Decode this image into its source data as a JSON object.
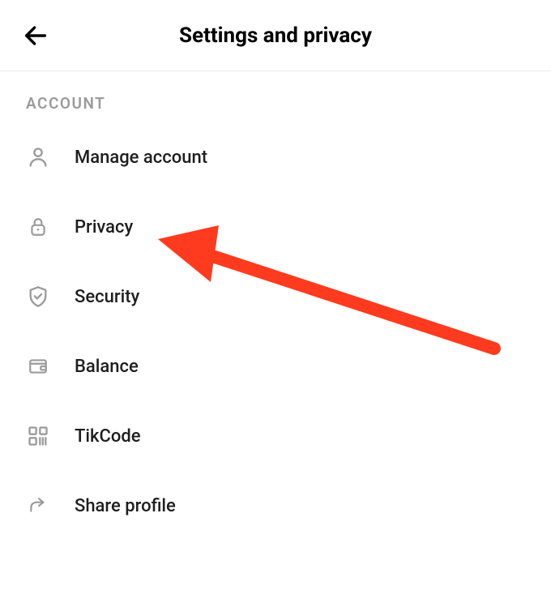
{
  "header": {
    "title": "Settings and privacy"
  },
  "section": {
    "heading": "ACCOUNT"
  },
  "items": [
    {
      "icon": "person",
      "label": "Manage account"
    },
    {
      "icon": "lock",
      "label": "Privacy"
    },
    {
      "icon": "shield",
      "label": "Security"
    },
    {
      "icon": "wallet",
      "label": "Balance"
    },
    {
      "icon": "tikcode",
      "label": "TikCode"
    },
    {
      "icon": "share",
      "label": "Share profile"
    }
  ],
  "annotation": {
    "arrow_color": "#ff3b1f"
  }
}
